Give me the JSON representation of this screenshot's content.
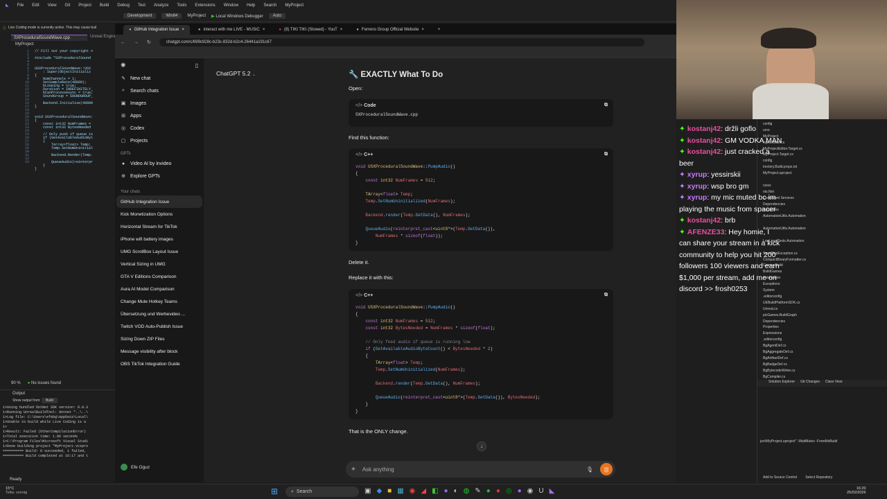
{
  "vs": {
    "menus": [
      "File",
      "Edit",
      "View",
      "Git",
      "Project",
      "Build",
      "Debug",
      "Test",
      "Analyze",
      "Tools",
      "Extensions",
      "Window",
      "Help",
      "Search",
      "MyProject"
    ],
    "toolbar": {
      "config": "Development",
      "platform": "Win64",
      "project": "MyProject",
      "run": "Local Windows Debugger",
      "auto": "Auto"
    },
    "live_coding": "Live Coding mode is currently active. This may cause buil",
    "editor_tab": "SXProceduralSoundWave.cpp",
    "editor_tab2": "Unreal Engine",
    "project_label": "MyProject",
    "line_numbers": "1\n2\n3\n4\n5\n6\n7\n8\n9\n10\n11\n12\n13\n14\n15\n16\n17\n18\n19\n20\n21\n22\n23\n24\n25\n26\n27\n28\n29\n30\n31\n32\n33",
    "code": "// Fill out your copyright n\n\n#include \"SXProceduralSound\n\n\nUSXProceduralSoundWave::USX\n    : Super(ObjectInitializ\n{\n    NumChannels = 1;\n    SetSampleRate(48000);\n    bLooping = true;\n    Duration = INDEFINITELY_\n    bCanProcessAsync = true;\n    SoundGroup = SOUNDGROUP_\n\n    Backend.Initialise(48000\n}\n\n\nvoid USXProceduralSoundWave:\n{\n    const int32 NumFrames =\n    const int32 BytesNeeded\n\n    // Only push if queue is\n    if (GetAvailableAudioByt\n    {\n        TArray<float> Temp;\n        Temp.SetNumUninitial\n\n        Backend.Render(Temp.\n\n        QueueAudio(reinterpr\n    }\n}",
    "zoom": "90 %",
    "issues": "No issues found",
    "output_title": "Output",
    "output_from_label": "Show output from:",
    "output_from": "Build",
    "output_lines": "1>Using bundled DotNet SDK version: 8.0.3\n1>Running UnrealBuildTool: dotnet \"..\\..\\\n1>Log file: C:\\Users\\efebg\\AppData\\Local\\\n1>Unable to build while Live Coding is a\n1>\n1>Result: Failed (OtherCompilationError)\n1>Total execution time: 1.06 seconds\n1>C:\\Program Files\\Microsoft Visual Studi\n1>Done building project \"MyProject.vcxpro\n========== Build: 0 succeeded, 1 failed,\n========== Build completed at 16:17 and t",
    "status": "Ready"
  },
  "browser": {
    "tabs": [
      {
        "label": "GitHub Integration Issue",
        "active": true
      },
      {
        "label": "interact with me LIVE - MUSIC",
        "active": false
      },
      {
        "label": "(8) TIKI TIKI (Slowed) - YouT",
        "active": false
      },
      {
        "label": "Ferreno Group Official Website",
        "active": false
      }
    ],
    "url": "chatgpt.com/c/699c928c-b23c-832d-b2c4-26441a191c67"
  },
  "sidebar": {
    "items": [
      {
        "icon": "✎",
        "label": "New chat"
      },
      {
        "icon": "⌕",
        "label": "Search chats"
      },
      {
        "icon": "▣",
        "label": "Images"
      },
      {
        "icon": "⊞",
        "label": "Apps"
      },
      {
        "icon": "◎",
        "label": "Codex"
      },
      {
        "icon": "▢",
        "label": "Projects"
      }
    ],
    "gpts_head": "GPTs",
    "gpts": [
      {
        "icon": "●",
        "label": "Video AI by invideo"
      },
      {
        "icon": "⊕",
        "label": "Explore GPTs"
      }
    ],
    "chats_head": "Your chats",
    "chats": [
      "GitHub Integration Issue",
      "Kick Monetization Options",
      "Horizontal Stream for TikTok",
      "iPhone wifi battery images",
      "UMG ScrollBox Layout Issue",
      "Vertical Sizing in UMG",
      "GTA V Editions Comparison",
      "Aura AI Model Comparison",
      "Change Mute Hotkey Teams",
      "Übersetzung und Werbevideo ...",
      "Twitch VOD Auto-Publish Issue",
      "Sizing Down ZIP Files",
      "Message visibility after block",
      "OBS TikTok Integration Guide"
    ],
    "user": "Efe Oguz"
  },
  "chat": {
    "model": "ChatGPT 5.2",
    "heading": "🔧 EXACTLY What To Do",
    "open_label": "Open:",
    "code_label": "Code",
    "filename": "SXProceduralSoundWave.cpp",
    "find_label": "Find this function:",
    "cpp_label": "C++",
    "delete_label": "Delete it.",
    "replace_label": "Replace it with this:",
    "only_change": "That is the ONLY change.",
    "composer_placeholder": "Ask anything"
  },
  "taskbar": {
    "weather_temp": "15°C",
    "weather_desc": "Teilw. sonnig",
    "search": "Search",
    "time": "16:20",
    "date": "25/02/2026"
  },
  "stream_chat": [
    {
      "user": "kostanj42",
      "msg": "držli goflo",
      "color": "#e84f9e"
    },
    {
      "user": "kostanj42",
      "msg": "GM VODKA MAN",
      "color": "#e84f9e"
    },
    {
      "user": "kostanj42",
      "msg": "just cracked a beer",
      "color": "#e84f9e"
    },
    {
      "user": "xyrup",
      "msg": "yessirskii",
      "color": "#c77bff"
    },
    {
      "user": "xyrup",
      "msg": "wsp bro gm",
      "color": "#c77bff"
    },
    {
      "user": "xyrup",
      "msg": "my mic muted bc im playing the music from spacer",
      "color": "#c77bff"
    },
    {
      "user": "kostanj42",
      "msg": "brb",
      "color": "#e84f9e"
    },
    {
      "user": "AFENZE33",
      "msg": "Hey homie, I can share your stream in a kick community to help you hit 200 followers 100 viewers and earn $1,000 per stream, add me on discord >> frosh0253",
      "color": "#e84f9e"
    }
  ],
  "solution": {
    "items": [
      "config",
      "urce",
      "MyProject",
      "roject.Build.cs",
      "MyProjectEditor.Target.cs",
      "MyProject.Target.cs",
      "config",
      "irectory.Build.props.txt",
      "MyProject.uproject",
      "",
      "ncies",
      "nts.Net",
      "Connected Services",
      "Dependencies",
      "Properties",
      "AutomationUtils.Automation",
      "",
      "AutomationUtils.Automation",
      "",
      "LowLevelTests.Automation",
      "",
      "SendSkipException.cs",
      "CompactBinaryFormatter.cs",
      "Games.Build",
      "BuildGames",
      "Automation",
      "Exceptions",
      "System",
      ".editorconfig",
      "UEBuildPlatformSDK.cs",
      "Unreal.cs",
      "picGames.BuildGraph",
      "Dependencies",
      "Properties",
      "Expressions",
      ".editorconfig",
      "BgAgentDef.cs",
      "BgAggregateDef.cs",
      "BgArtifactDef.cs",
      "BgBadgeDef.cs",
      "BgBytecodeWriter.cs",
      "BgCompiler.cs"
    ],
    "tabs": [
      "Solution Explorer",
      "Git Changes",
      "Class View"
    ],
    "cmdline": "ject\\MyProject.uproject\" -WaitMutex -FromMsBuild",
    "add_source": "Add to Source Control",
    "select_repo": "Select Repository"
  }
}
